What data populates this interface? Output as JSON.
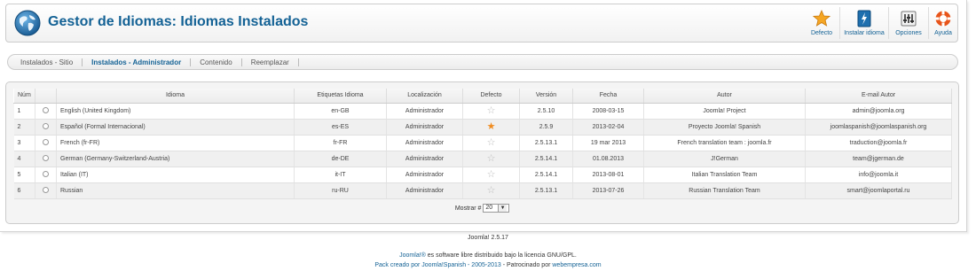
{
  "header": {
    "title": "Gestor de Idiomas: Idiomas Instalados",
    "buttons": [
      {
        "label": "Defecto",
        "icon": "star-icon"
      },
      {
        "label": "Instalar idioma",
        "icon": "install-icon"
      },
      {
        "label": "Opciones",
        "icon": "options-icon"
      },
      {
        "label": "Ayuda",
        "icon": "help-icon"
      }
    ]
  },
  "submenu": {
    "tabs": [
      {
        "label": "Instalados - Sitio",
        "active": false
      },
      {
        "label": "Instalados - Administrador",
        "active": true
      },
      {
        "label": "Contenido",
        "active": false
      },
      {
        "label": "Reemplazar",
        "active": false
      }
    ]
  },
  "table": {
    "columns": [
      "Núm",
      "Idioma",
      "Etiquetas Idioma",
      "Localización",
      "Defecto",
      "Versión",
      "Fecha",
      "Autor",
      "E-mail Autor"
    ],
    "rows": [
      {
        "num": "1",
        "language": "English (United Kingdom)",
        "tag": "en-GB",
        "location": "Administrador",
        "default": false,
        "version": "2.5.10",
        "date": "2008-03-15",
        "author": "Joomla! Project",
        "email": "admin@joomla.org"
      },
      {
        "num": "2",
        "language": "Español (Formal Internacional)",
        "tag": "es-ES",
        "location": "Administrador",
        "default": true,
        "version": "2.5.9",
        "date": "2013-02-04",
        "author": "Proyecto Joomla! Spanish",
        "email": "joomlaspanish@joomlaspanish.org"
      },
      {
        "num": "3",
        "language": "French (fr-FR)",
        "tag": "fr-FR",
        "location": "Administrador",
        "default": false,
        "version": "2.5.13.1",
        "date": "19 mar 2013",
        "author": "French translation team : joomla.fr",
        "email": "traduction@joomla.fr"
      },
      {
        "num": "4",
        "language": "German (Germany-Switzerland-Austria)",
        "tag": "de-DE",
        "location": "Administrador",
        "default": false,
        "version": "2.5.14.1",
        "date": "01.08.2013",
        "author": "J!German",
        "email": "team@jgerman.de"
      },
      {
        "num": "5",
        "language": "Italian (IT)",
        "tag": "it-IT",
        "location": "Administrador",
        "default": false,
        "version": "2.5.14.1",
        "date": "2013-08-01",
        "author": "Italian Translation Team",
        "email": "info@joomla.it"
      },
      {
        "num": "6",
        "language": "Russian",
        "tag": "ru-RU",
        "location": "Administrador",
        "default": false,
        "version": "2.5.13.1",
        "date": "2013-07-26",
        "author": "Russian Translation Team",
        "email": "smart@joomlaportal.ru"
      }
    ]
  },
  "pager": {
    "label": "Mostrar #",
    "value": "20"
  },
  "footer": {
    "version": "Joomla! 2.5.17",
    "license_link": "Joomla!®",
    "license_text": " es software libre distribuido bajo la licencia GNU/GPL.",
    "pack_link": "Pack creado por Joomla!Spanish - 2005-2013",
    "sponsor_text": " - Patrocinado por ",
    "sponsor_link": "webempresa.com"
  },
  "colors": {
    "accent": "#146295",
    "star_default": "#f08c20"
  }
}
